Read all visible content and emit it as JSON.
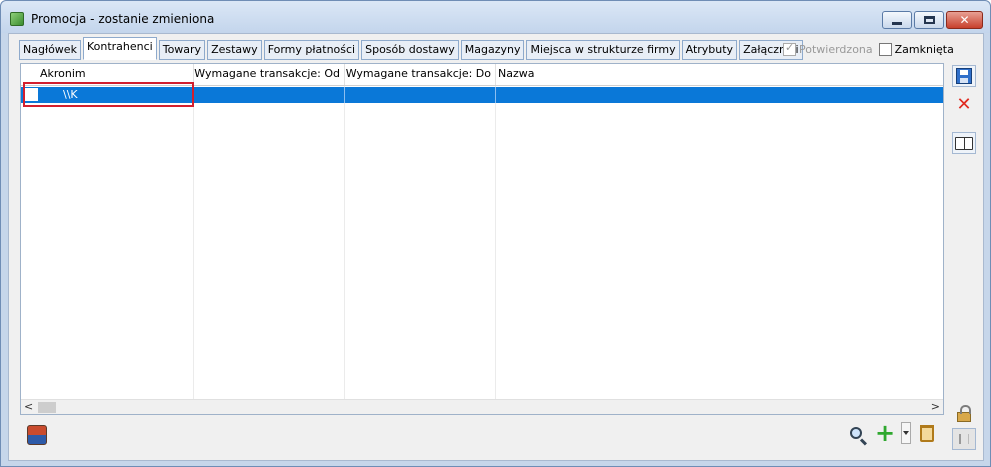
{
  "window": {
    "title": "Promocja - zostanie zmieniona",
    "minimize_icon": "minimize-icon",
    "maximize_icon": "maximize-icon",
    "close_glyph": "✕"
  },
  "tabs": [
    {
      "label": "Nagłówek"
    },
    {
      "label": "Kontrahenci",
      "active": true
    },
    {
      "label": "Towary"
    },
    {
      "label": "Zestawy"
    },
    {
      "label": "Formy płatności"
    },
    {
      "label": "Sposób dostawy"
    },
    {
      "label": "Magazyny"
    },
    {
      "label": "Miejsca w strukturze firmy"
    },
    {
      "label": "Atrybuty"
    },
    {
      "label": "Załączniki"
    }
  ],
  "checks": {
    "confirmed_label": "Potwierdzona",
    "confirmed_checked": true,
    "closed_label": "Zamknięta",
    "closed_checked": false
  },
  "grid": {
    "columns": [
      "Akronim",
      "Wymagane transakcje: Od",
      "Wymagane transakcje: Do",
      "Nazwa"
    ],
    "rows": [
      {
        "checked": false,
        "akronim": "\\\\K",
        "od": "",
        "do": "",
        "nazwa": ""
      }
    ],
    "scroll_left": "<",
    "scroll_right": ">"
  },
  "colors": {
    "selection": "#0a78d8",
    "highlight_box": "#d31f2e",
    "accent": "#c6d6ea"
  },
  "icons": {
    "save": "save-icon",
    "cancel": "close-icon",
    "book": "book-icon",
    "lock": "lock-icon",
    "pin": "pin-icon",
    "contacts": "contacts-icon",
    "search": "search-icon",
    "add": "add-icon",
    "dropdown": "chevron-down-icon",
    "delete": "trash-icon"
  }
}
